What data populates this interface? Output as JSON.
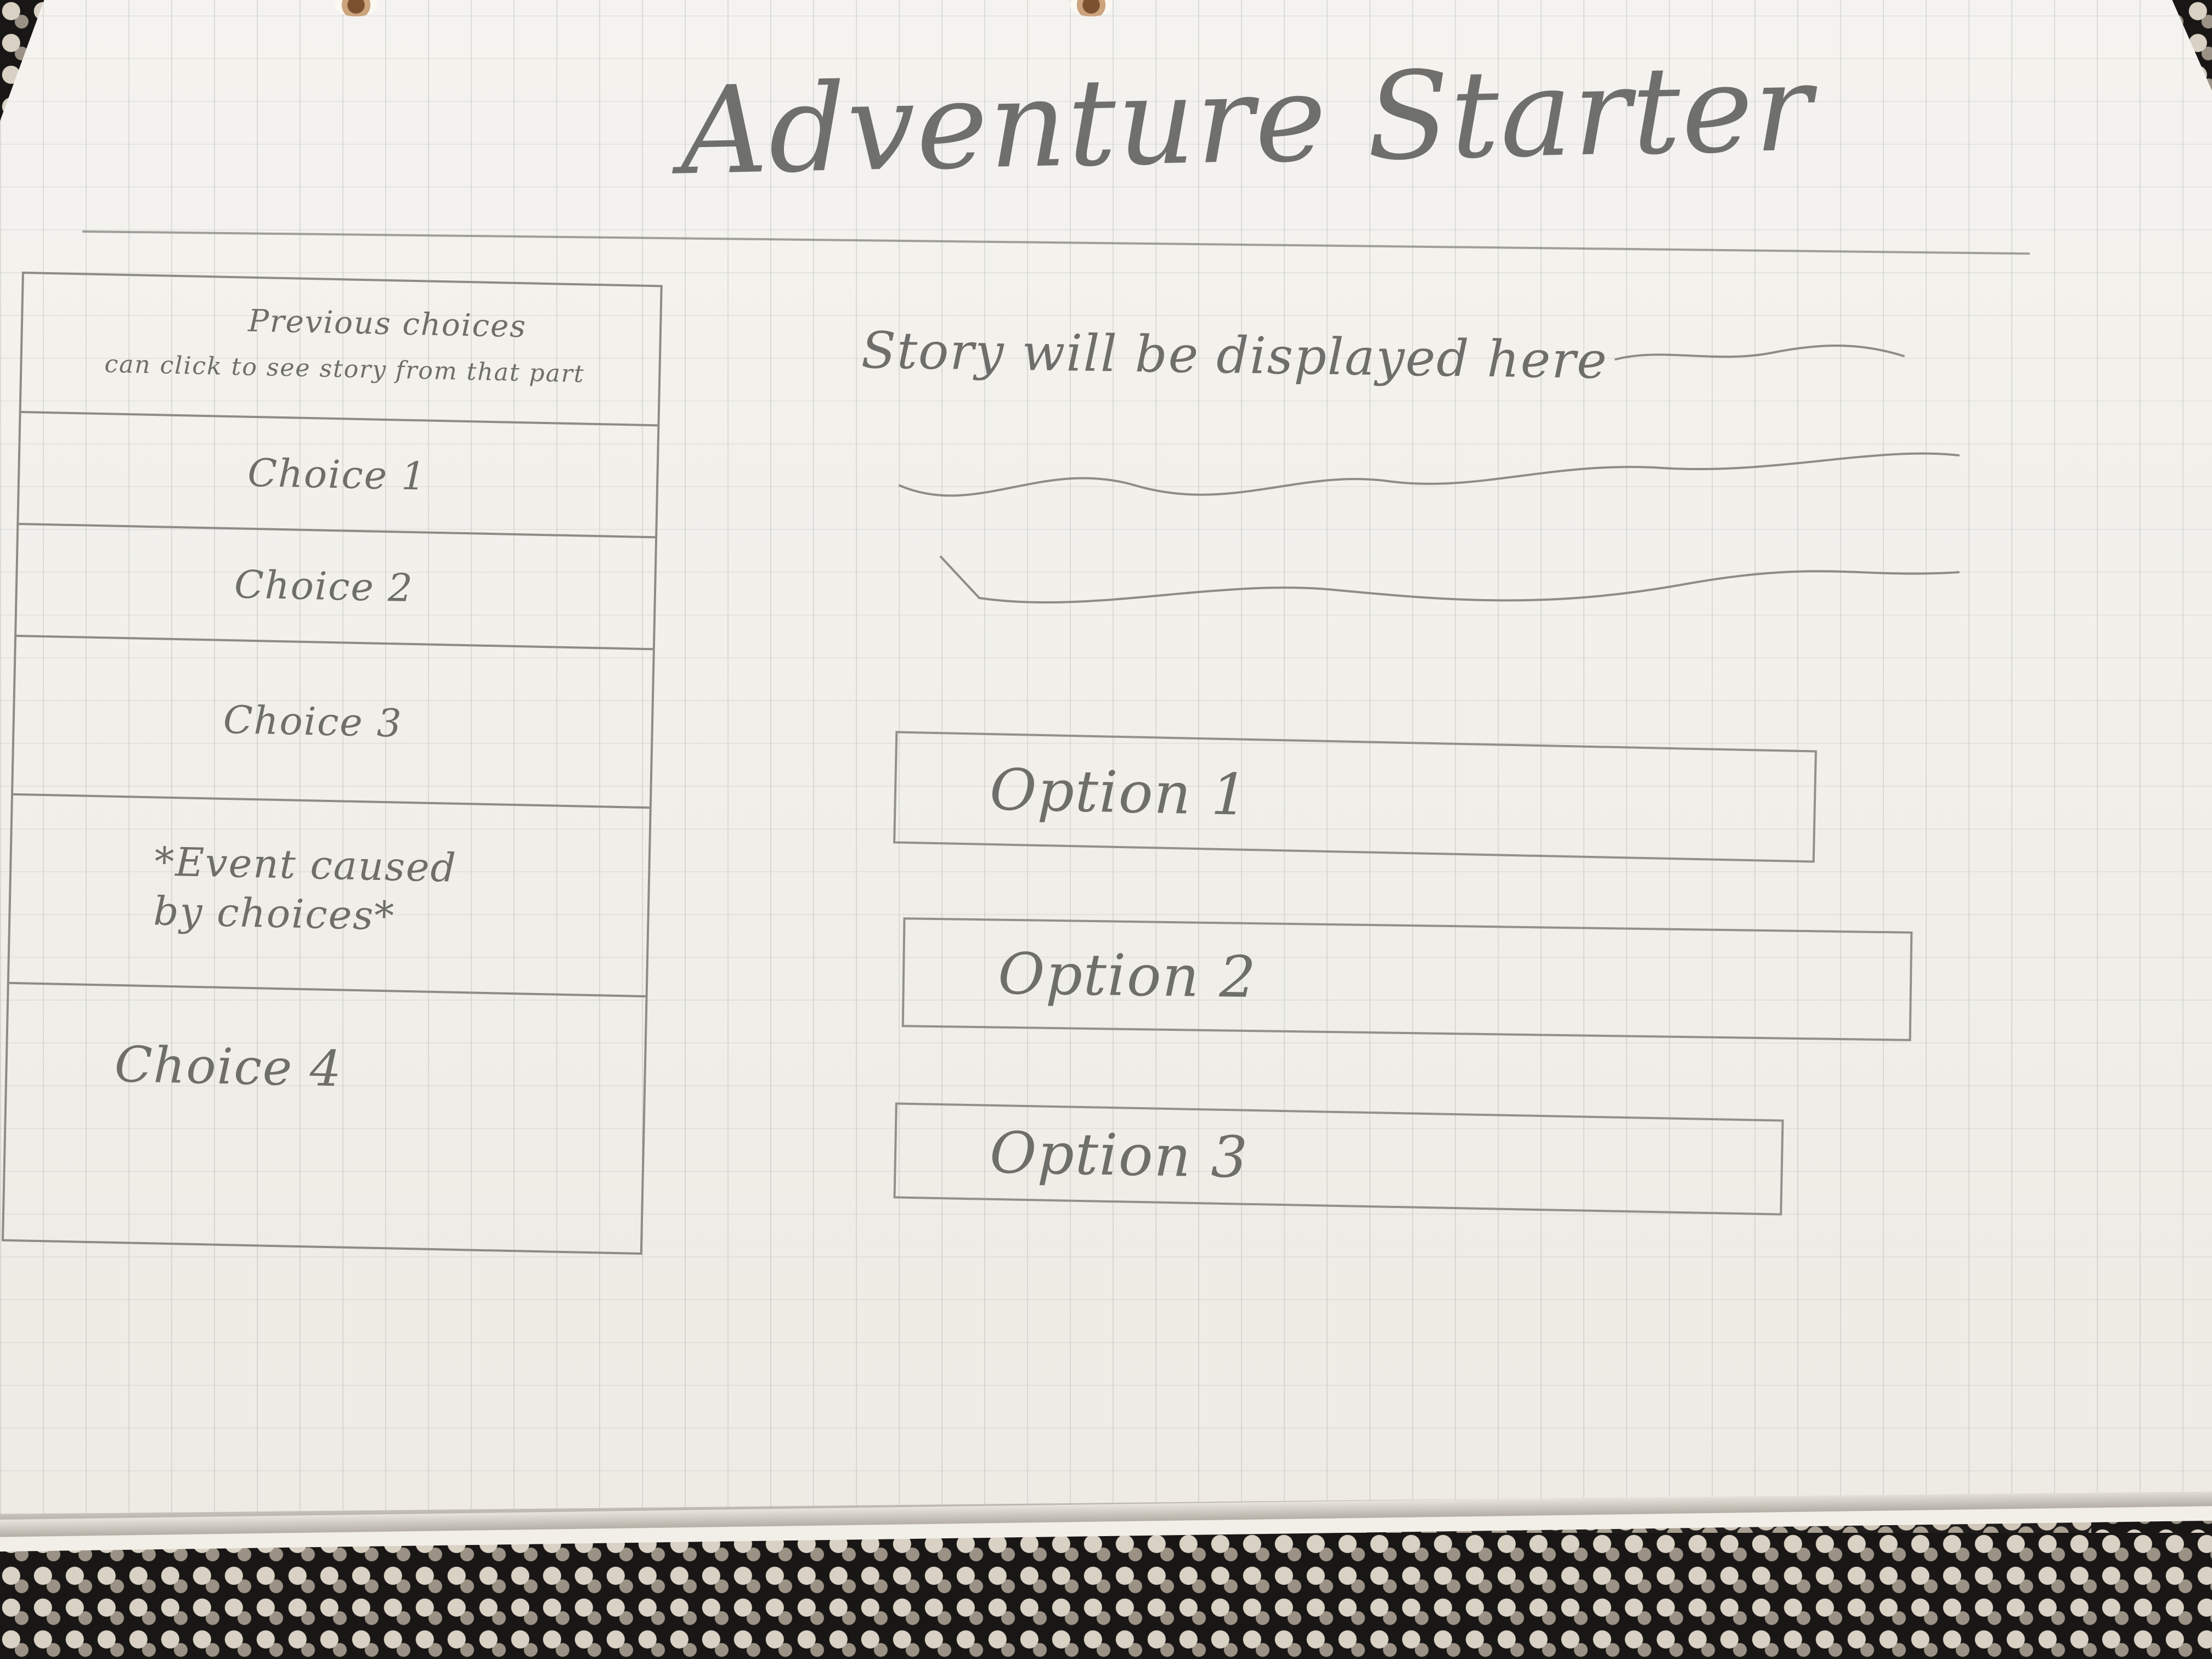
{
  "app": {
    "title": "Adventure Starter"
  },
  "sidebar": {
    "title": "Previous choices",
    "subtitle": "can click to see story from that part",
    "items": [
      {
        "label": "Choice 1"
      },
      {
        "label": "Choice 2"
      },
      {
        "label": "Choice 3"
      },
      {
        "label": "*Event caused\nby choices*"
      },
      {
        "label": "Choice 4"
      }
    ]
  },
  "main": {
    "story_placeholder": "Story will be displayed here",
    "options": [
      {
        "label": "Option 1"
      },
      {
        "label": "Option 2"
      },
      {
        "label": "Option 3"
      }
    ]
  }
}
